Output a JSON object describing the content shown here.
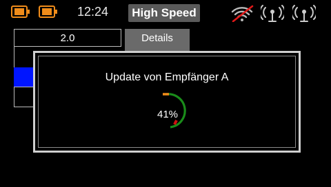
{
  "status_bar": {
    "battery_icons": [
      "battery-icon",
      "battery-icon"
    ],
    "clock": "12:24",
    "mode_label": "High Speed",
    "signal_icons": [
      "signal-crossed-icon",
      "antenna-icon",
      "antenna-icon"
    ]
  },
  "table": {
    "version_value": "2.0",
    "details_label": "Details"
  },
  "dialog": {
    "title": "Update von Empfänger A",
    "progress_percent": 41,
    "progress_label": "41%"
  },
  "colors": {
    "accent_orange": "#f08c1a",
    "progress_green": "#1a8c1a",
    "progress_red": "#d01010",
    "selected_blue": "#0015ff"
  }
}
